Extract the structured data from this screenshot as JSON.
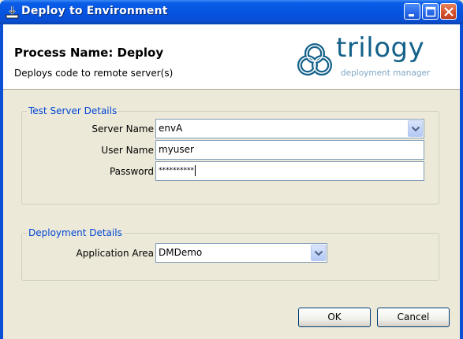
{
  "window": {
    "title": "Deploy to Environment",
    "icon": "deploy-icon"
  },
  "header": {
    "process_name": "Process Name: Deploy",
    "description": "Deploys code to remote server(s)",
    "logo": {
      "word": "trilogy",
      "tagline": "deployment manager"
    }
  },
  "test_server": {
    "legend": "Test Server Details",
    "server_name": {
      "label": "Server Name",
      "value": "envA"
    },
    "user_name": {
      "label": "User Name",
      "value": "myuser"
    },
    "password": {
      "label": "Password",
      "value": "**********"
    }
  },
  "deployment": {
    "legend": "Deployment Details",
    "application_area": {
      "label": "Application Area",
      "value": "DMDemo"
    }
  },
  "buttons": {
    "ok": "OK",
    "cancel": "Cancel"
  },
  "colors": {
    "title_bar": "#0553e0",
    "legend_text": "#0046d5",
    "dialog_bg": "#ece9d8",
    "logo": "#14618a"
  }
}
